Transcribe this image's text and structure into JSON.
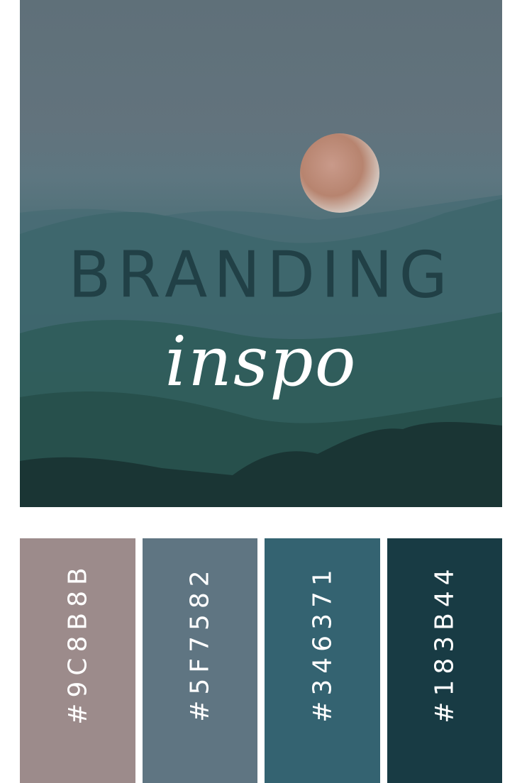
{
  "title": "BRANDING",
  "subtitle": "inspo",
  "palette": [
    {
      "hex": "#9C8B8B",
      "label": "#9C8B8B"
    },
    {
      "hex": "#5F7582",
      "label": "#5F7582"
    },
    {
      "hex": "#346371",
      "label": "#346371"
    },
    {
      "hex": "#183B44",
      "label": "#183B44"
    }
  ]
}
